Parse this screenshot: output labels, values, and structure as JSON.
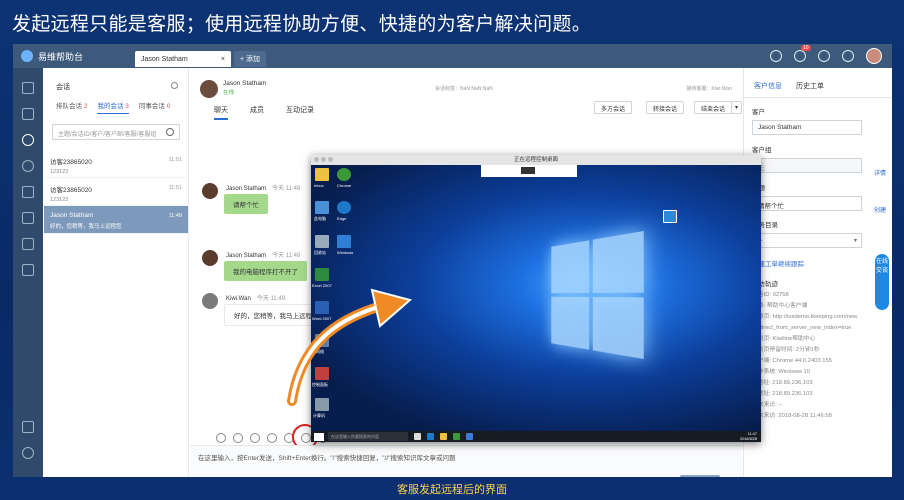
{
  "headline": "发起远程只能是客服；使用远程协助方便、快捷的为客户解决问题。",
  "caption": "客服发起远程后的界面",
  "app": {
    "brand": "易维帮助台",
    "tab_active": "Jason Statham",
    "tab_close": "×",
    "tab_add": "+ 添加",
    "msg_badge": "10"
  },
  "sessions": {
    "title": "会话",
    "tabs": [
      {
        "label": "排队会话",
        "count": "2"
      },
      {
        "label": "我的会话",
        "count": "3"
      },
      {
        "label": "同事会话",
        "count": "0"
      }
    ],
    "search_placeholder": "主题/会话ID/客户/客户邮/客服/客服组",
    "items": [
      {
        "name": "访客23865020",
        "sub": "123123",
        "time": "11:51"
      },
      {
        "name": "访客23865020",
        "sub": "123123",
        "time": "11:51"
      },
      {
        "name": "Jason Statham",
        "sub": "好的，您稍等，我马上远程您",
        "time": "11:49"
      }
    ]
  },
  "chat": {
    "name": "Jason Statham",
    "status": "在线",
    "meta_left": "会话标签：NaN:NaN:NaN",
    "meta_right": "接待客服：Kiwi.Wan",
    "tabs": [
      "聊天",
      "成员",
      "互动记录"
    ],
    "buttons": {
      "multi": "多方会话",
      "transfer": "转接会话",
      "end": "结束会话",
      "more": "▾"
    },
    "messages": [
      {
        "name": "Jason Statham",
        "time": "今天 11:49",
        "text": "请帮个忙"
      },
      {
        "name": "Jason Statham",
        "time": "今天 11:49",
        "text": "我的电脑程序打不开了"
      },
      {
        "name": "Kiwi.Wan",
        "time": "今天 11:49",
        "text": "好的，您稍等，我马上远程您"
      }
    ],
    "input_placeholder": "在这里输入，按Enter发送，Shift+Enter换行。\"/\"搜索快捷回复，\"//\"搜索知识库文章或问题",
    "reply_button": "回复"
  },
  "remote": {
    "title": "正在远程控制桌面",
    "desktop_icons": [
      {
        "label": "Inbox"
      },
      {
        "label": "Chrome"
      },
      {
        "label": "此电脑"
      },
      {
        "label": "Edge"
      },
      {
        "label": "回收站"
      },
      {
        "label": "Windows"
      },
      {
        "label": "Excel 2007"
      },
      {
        "label": "Word 2007"
      },
      {
        "label": "网络"
      },
      {
        "label": "控制面板"
      },
      {
        "label": "计算机"
      }
    ],
    "search_placeholder": "在这里输入你要搜索的内容",
    "clock_time": "11:47",
    "clock_date": "2018/8/28"
  },
  "right": {
    "tabs": [
      "客户信息",
      "历史工单"
    ],
    "customer_label": "客户",
    "customer_value": "Jason Statham",
    "detail_link": "详情",
    "group_label": "客户组",
    "group_value": "无",
    "group_link": "创建",
    "subject_label": "主题",
    "subject_value": "请帮个忙",
    "category_label": "服务目录",
    "category_value": "--",
    "create_ticket": "创建工单继续跟踪",
    "visit_title": "来访轨迹",
    "visit_lines": [
      "会话ID: 92758",
      "来源: 帮助中心客户端",
      "来源页: http://iosdemo.tkeeping.com/new",
      "/redirect_from_server_new_index=true",
      "当前页: Kiwiline帮助中心",
      "当前页停留时间: 2分钟1秒",
      "客户端: Chrome 44.0.2403.155",
      "操作系统: Windows 10",
      "IP地址: 218.89.236.103",
      "IP地址: 218.89.236.103",
      "上次来访: --",
      "本次来访: 2018-08-28 11:46:58"
    ],
    "float_button": "在线交谈"
  }
}
